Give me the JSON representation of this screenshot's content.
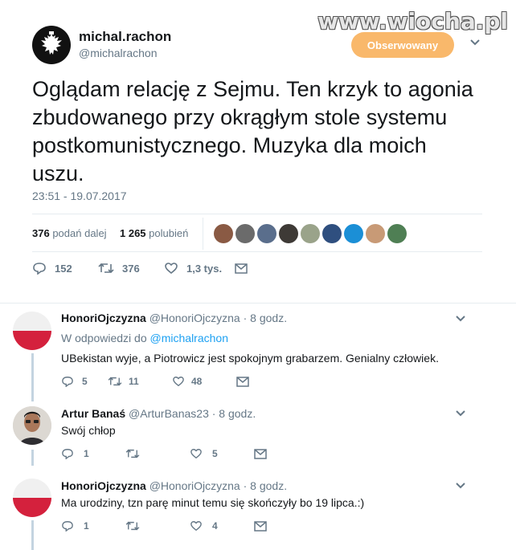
{
  "watermark": "www.wiocha.pl",
  "main_tweet": {
    "author_name": "michal.rachon",
    "author_handle": "@michalrachon",
    "follow_label": "Obserwowany",
    "text": "Oglądam relację z Sejmu. Ten krzyk to agonia zbudowanego przy okrągłym stole systemu postkomunistycznego. Muzyka dla moich uszu.",
    "timestamp": "23:51 - 19.07.2017",
    "retweets_count": "376",
    "retweets_label": "podań dalej",
    "likes_count": "1 265",
    "likes_label": "polubień",
    "liker_colors": [
      "#8a5a44",
      "#6b6b6b",
      "#5a6e8c",
      "#3e3a36",
      "#9aa38a",
      "#2f4f7f",
      "#1b8fd6",
      "#c89a76",
      "#4f7f54"
    ],
    "actions": {
      "replies": "152",
      "retweets": "376",
      "likes": "1,3 tys."
    },
    "icons": [
      "eagle-emblem-icon",
      "chevron-down-icon",
      "reply-icon",
      "retweet-icon",
      "heart-icon",
      "mail-icon"
    ]
  },
  "replies": [
    {
      "name": "HonoriOjczyzna",
      "handle": "@HonoriOjczyzna",
      "time": "· 8 godz.",
      "reply_to_prefix": "W odpowiedzi do",
      "reply_to_handle": "@michalrachon",
      "text": "UBekistan wyje, a Piotrowicz jest spokojnym grabarzem. Genialny człowiek.",
      "replies": "5",
      "retweets": "11",
      "likes": "48"
    },
    {
      "name": "Artur Banaś",
      "handle": "@ArturBanas23",
      "time": "· 8 godz.",
      "text": "Swój chłop",
      "replies": "1",
      "retweets": "",
      "likes": "5"
    },
    {
      "name": "HonoriOjczyzna",
      "handle": "@HonoriOjczyzna",
      "time": "· 8 godz.",
      "text": "Ma urodziny, tzn parę minut temu się skończyły bo 19 lipca.:)",
      "replies": "1",
      "retweets": "",
      "likes": "4"
    }
  ],
  "colors": {
    "follow_button": "#f9b86b",
    "link": "#1da1f2",
    "secondary_text": "#657786",
    "flag_red": "#d4213d"
  }
}
